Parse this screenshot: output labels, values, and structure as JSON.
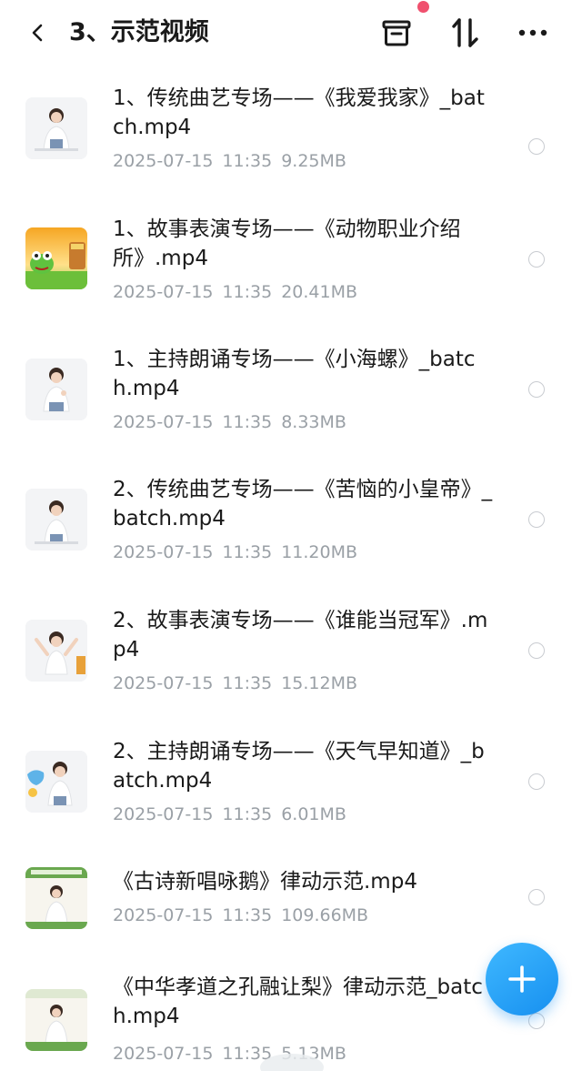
{
  "header": {
    "title": "3、示范视频",
    "back_icon": "back-arrow-icon",
    "archive_icon": "archive-box-icon",
    "sort_icon": "sort-arrows-icon",
    "more_icon": "more-dots-icon",
    "notification_dot_color": "#f0506e"
  },
  "files": [
    {
      "name": "1、传统曲艺专场——《我爱我家》_batch.mp4",
      "date": "2025-07-15",
      "time": "11:35",
      "size": "9.25MB",
      "thumb": "person-white-shirt"
    },
    {
      "name": "1、故事表演专场——《动物职业介绍所》.mp4",
      "date": "2025-07-15",
      "time": "11:35",
      "size": "20.41MB",
      "thumb": "cartoon-frog"
    },
    {
      "name": "1、主持朗诵专场——《小海螺》_batch.mp4",
      "date": "2025-07-15",
      "time": "11:35",
      "size": "8.33MB",
      "thumb": "person-white-shirt"
    },
    {
      "name": "2、传统曲艺专场——《苦恼的小皇帝》_batch.mp4",
      "date": "2025-07-15",
      "time": "11:35",
      "size": "11.20MB",
      "thumb": "person-white-shirt"
    },
    {
      "name": "2、故事表演专场——《谁能当冠军》.mp4",
      "date": "2025-07-15",
      "time": "11:35",
      "size": "15.12MB",
      "thumb": "person-arms-raised"
    },
    {
      "name": "2、主持朗诵专场——《天气早知道》_batch.mp4",
      "date": "2025-07-15",
      "time": "11:35",
      "size": "6.01MB",
      "thumb": "person-with-weather-art"
    },
    {
      "name": "《古诗新唱咏鹅》律动示范.mp4",
      "date": "2025-07-15",
      "time": "11:35",
      "size": "109.66MB",
      "thumb": "person-green-banner"
    },
    {
      "name": "《中华孝道之孔融让梨》律动示范_batch.mp4",
      "date": "2025-07-15",
      "time": "11:35",
      "size": "5.13MB",
      "thumb": "person-green-banner"
    }
  ],
  "fab": {
    "icon": "plus-icon",
    "color": "#1790f0"
  }
}
